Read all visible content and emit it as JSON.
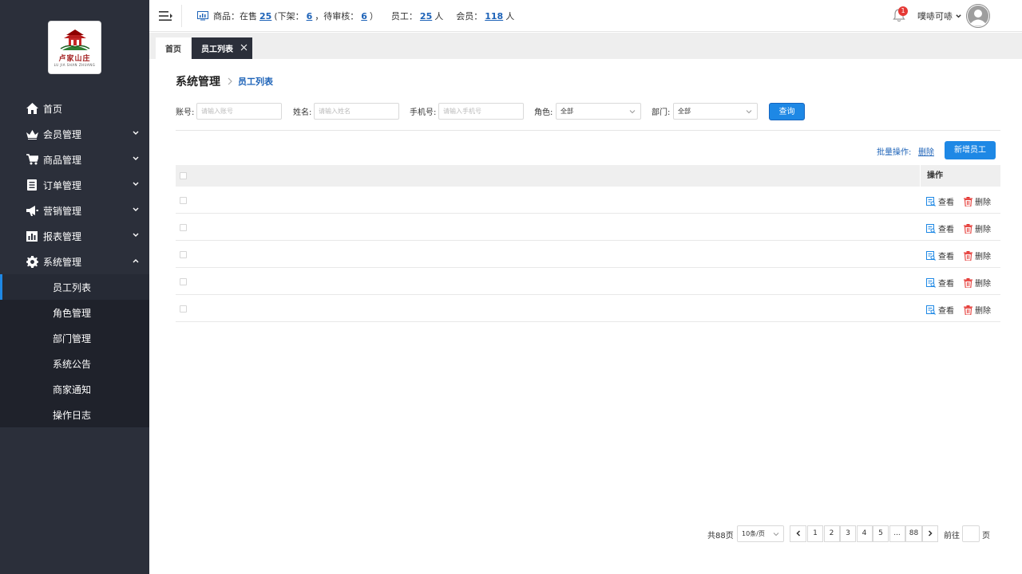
{
  "brand": {
    "logo_text": "卢家山庄",
    "logo_sub": "LU JIA SHAN ZHUANG"
  },
  "sidebar": {
    "items": [
      {
        "label": "首页",
        "icon": "home-icon"
      },
      {
        "label": "会员管理",
        "icon": "crown-icon"
      },
      {
        "label": "商品管理",
        "icon": "cart-icon"
      },
      {
        "label": "订单管理",
        "icon": "order-icon"
      },
      {
        "label": "营销管理",
        "icon": "megaphone-icon"
      },
      {
        "label": "报表管理",
        "icon": "chart-icon"
      },
      {
        "label": "系统管理",
        "icon": "gear-icon"
      }
    ],
    "submenu": [
      "员工列表",
      "角色管理",
      "部门管理",
      "系统公告",
      "商家通知",
      "操作日志"
    ]
  },
  "topbar": {
    "goods_label": "商品：在售",
    "on_sale": "25",
    "off_label": "(下架：",
    "off_shelf": "6",
    "pending_label": "，待审核：",
    "pending": "6",
    "paren_close": "）",
    "staff_label": "员工：",
    "staff": "25",
    "staff_unit": "人",
    "member_label": "会员：",
    "members": "118",
    "member_unit": "人",
    "notification_count": "1",
    "user_name": "噗哧可哧"
  },
  "tabs": {
    "home": "首页",
    "active": "员工列表"
  },
  "breadcrumb": {
    "main": "系统管理",
    "current": "员工列表"
  },
  "filters": {
    "account_label": "账号:",
    "account_placeholder": "请输入账号",
    "name_label": "姓名:",
    "name_placeholder": "请输入姓名",
    "phone_label": "手机号:",
    "phone_placeholder": "请输入手机号",
    "role_label": "角色:",
    "role_value": "全部",
    "dept_label": "部门:",
    "dept_value": "全部",
    "query_label": "查询"
  },
  "actions": {
    "batch_label": "批量操作:",
    "batch_delete": "删除",
    "add_label": "新增员工"
  },
  "table": {
    "ops_header": "操作",
    "view_label": "查看",
    "delete_label": "删除",
    "row_count": 5
  },
  "pagination": {
    "total": "共88页",
    "page_size": "10条/页",
    "pages": [
      "1",
      "2",
      "3",
      "4",
      "5",
      "...",
      "88"
    ],
    "goto_label": "前往",
    "page_label": "页"
  },
  "colors": {
    "sidebar_bg": "#2b2f3a",
    "accent": "#1e88e5",
    "link": "#1e63b8",
    "danger": "#e53935"
  }
}
